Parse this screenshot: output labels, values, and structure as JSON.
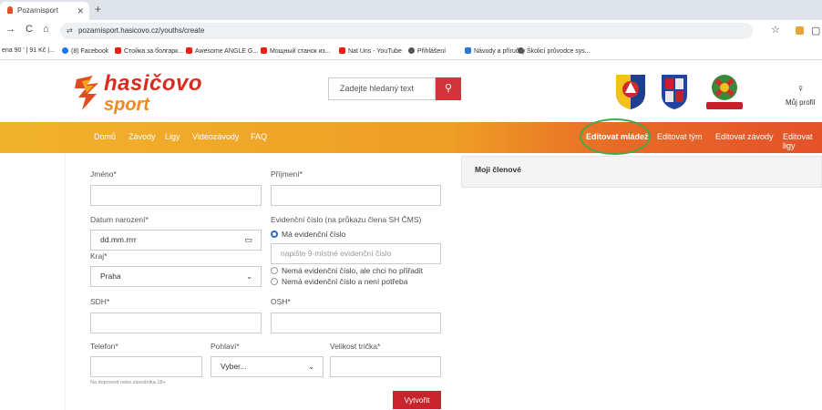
{
  "browser": {
    "tab_title": "Pozarnisport",
    "url": "pozarnisport.hasicovo.cz/youths/create",
    "bookmarks": [
      "ena 90 ' | 91 Kč |...",
      "(8) Facebook",
      "Стойка за болгарк...",
      "Awesome ANGLE G...",
      "Мощный станок из...",
      "Nat Uns - YouTube",
      "Přihlášení",
      "Návody a příručky",
      "Školicí průvodce sys..."
    ]
  },
  "header": {
    "logo_line1": "hasičovo",
    "logo_line2": "sport",
    "search_placeholder": "Zadejte hledaný text",
    "profile_label": "Můj profil"
  },
  "nav": {
    "left": [
      "Domů",
      "Závody",
      "Ligy",
      "Videozávody",
      "FAQ"
    ],
    "right": [
      "Editovat mládež",
      "Editovat tým",
      "Editovat závody",
      "Editovat ligy"
    ]
  },
  "form": {
    "first_name_label": "Jméno*",
    "last_name_label": "Příjmení*",
    "birth_label": "Datum narození*",
    "birth_placeholder": "dd.mm.rrrr",
    "evid_label": "Evidenční číslo (na průkazu člena SH ČMS)",
    "radio_has": "Má evidenční číslo",
    "evid_placeholder": "napište 9-místné evidenční číslo",
    "radio_assign": "Nemá evidenční číslo, ale chci ho přiřadit",
    "radio_none": "Nemá evidenční číslo a není potřeba",
    "region_label": "Kraj*",
    "region_value": "Praha",
    "sdh_label": "SDH*",
    "osh_label": "OSH*",
    "phone_label": "Telefon*",
    "gender_label": "Pohlaví*",
    "gender_value": "Vyber...",
    "shirt_label": "Velikost trička*",
    "phone_note": "Na doprovod nebo závodníka 18+",
    "submit_label": "Vytvořit"
  },
  "panel": {
    "title": "Moji členové"
  }
}
